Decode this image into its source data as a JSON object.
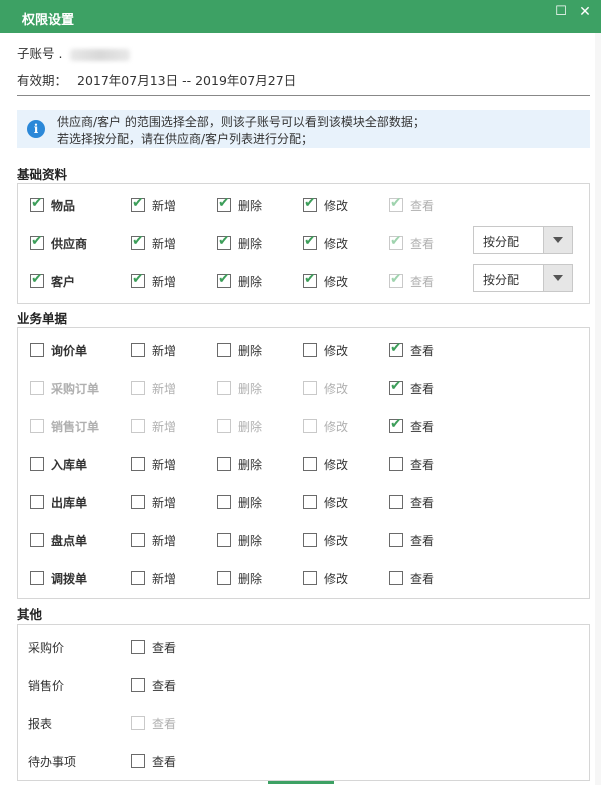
{
  "window": {
    "title": "权限设置",
    "maximize": "☐",
    "close": "✕"
  },
  "account": {
    "sub_label": "子账号 .",
    "validity_label": "有效期：",
    "validity_value": "2017年07月13日 -- 2019年07月27日"
  },
  "notice": {
    "line1": "供应商/客户 的范围选择全部，则该子账号可以看到该模块全部数据；",
    "line2": "若选择按分配，请在供应商/客户列表进行分配；"
  },
  "basic": {
    "title": "基础资料",
    "rows": [
      {
        "name": "物品",
        "checks": [
          true,
          true,
          true,
          true,
          true
        ],
        "disabled": [
          false,
          false,
          false,
          false,
          true
        ]
      },
      {
        "name": "供应商",
        "checks": [
          true,
          true,
          true,
          true,
          true
        ],
        "disabled": [
          false,
          false,
          false,
          false,
          true
        ],
        "select": "按分配"
      },
      {
        "name": "客户",
        "checks": [
          true,
          true,
          true,
          true,
          true
        ],
        "disabled": [
          false,
          false,
          false,
          false,
          true
        ],
        "select": "按分配"
      }
    ],
    "actions": [
      "新增",
      "删除",
      "修改",
      "查看"
    ]
  },
  "business": {
    "title": "业务单据",
    "actions": [
      "新增",
      "删除",
      "修改",
      "查看"
    ],
    "rows": [
      {
        "name": "询价单",
        "checks": [
          false,
          false,
          false,
          false,
          true
        ],
        "disabled": [
          false,
          false,
          false,
          false,
          false
        ]
      },
      {
        "name": "采购订单",
        "checks": [
          false,
          false,
          false,
          false,
          true
        ],
        "disabled": [
          true,
          true,
          true,
          true,
          false
        ]
      },
      {
        "name": "销售订单",
        "checks": [
          false,
          false,
          false,
          false,
          true
        ],
        "disabled": [
          true,
          true,
          true,
          true,
          false
        ]
      },
      {
        "name": "入库单",
        "checks": [
          false,
          false,
          false,
          false,
          false
        ],
        "disabled": [
          false,
          false,
          false,
          false,
          false
        ]
      },
      {
        "name": "出库单",
        "checks": [
          false,
          false,
          false,
          false,
          false
        ],
        "disabled": [
          false,
          false,
          false,
          false,
          false
        ]
      },
      {
        "name": "盘点单",
        "checks": [
          false,
          false,
          false,
          false,
          false
        ],
        "disabled": [
          false,
          false,
          false,
          false,
          false
        ]
      },
      {
        "name": "调拨单",
        "checks": [
          false,
          false,
          false,
          false,
          false
        ],
        "disabled": [
          false,
          false,
          false,
          false,
          false
        ]
      }
    ]
  },
  "other": {
    "title": "其他",
    "view": "查看",
    "rows": [
      {
        "name": "采购价",
        "checked": false,
        "disabled": false
      },
      {
        "name": "销售价",
        "checked": false,
        "disabled": false
      },
      {
        "name": "报表",
        "checked": false,
        "disabled": true
      },
      {
        "name": "待办事项",
        "checked": false,
        "disabled": false
      }
    ]
  },
  "colors": {
    "accent": "#3da164",
    "check": "#3d9e5a",
    "info_bg": "#e8f2fb",
    "info_icon": "#2b88d8"
  },
  "icons": {
    "info": "info-icon",
    "check": "check-icon",
    "dropdown": "caret-down-icon"
  }
}
